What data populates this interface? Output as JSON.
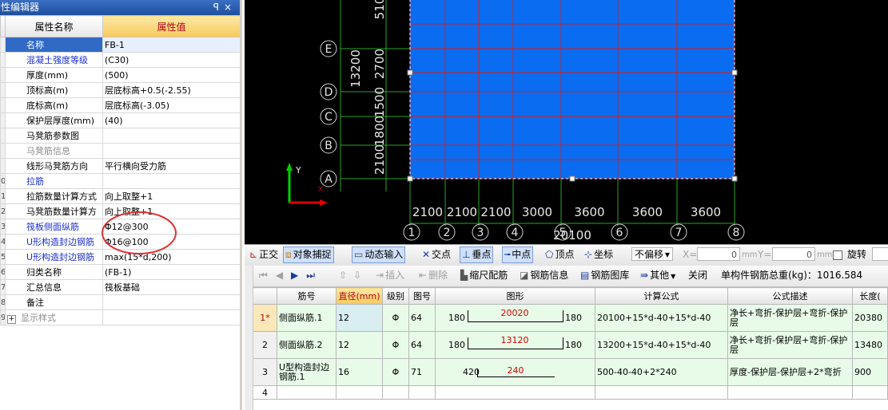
{
  "prop_editor": {
    "title": "性编辑器",
    "title_buttons": "ꟼ ×",
    "header_name": "属性名称",
    "header_value": "属性值",
    "rows": [
      {
        "num": "",
        "name": "名称",
        "value": "FB-1",
        "style": "selected"
      },
      {
        "num": "",
        "name": "混凝土强度等级",
        "value": "(C30)",
        "style": "blue"
      },
      {
        "num": "",
        "name": "厚度(mm)",
        "value": "(500)",
        "style": ""
      },
      {
        "num": "",
        "name": "顶标高(m)",
        "value": "层底标高+0.5(-2.55)",
        "style": ""
      },
      {
        "num": "",
        "name": "底标高(m)",
        "value": "层底标高(-3.05)",
        "style": ""
      },
      {
        "num": "",
        "name": "保护层厚度(mm)",
        "value": "(40)",
        "style": ""
      },
      {
        "num": "",
        "name": "马凳筋参数图",
        "value": "",
        "style": ""
      },
      {
        "num": "",
        "name": "马凳筋信息",
        "value": "",
        "style": "gray"
      },
      {
        "num": "",
        "name": "线形马凳筋方向",
        "value": "平行横向受力筋",
        "style": ""
      },
      {
        "num": "0",
        "name": "拉筋",
        "value": "",
        "style": "blue"
      },
      {
        "num": "1",
        "name": "拉筋数量计算方式",
        "value": "向上取整+1",
        "style": ""
      },
      {
        "num": "2",
        "name": "马凳筋数量计算方",
        "value": "向上取整+1",
        "style": ""
      },
      {
        "num": "3",
        "name": "筏板侧面纵筋",
        "value": "Φ12@300",
        "style": "blue"
      },
      {
        "num": "4",
        "name": "U形构造封边钢筋",
        "value": "Φ16@100",
        "style": "blue"
      },
      {
        "num": "5",
        "name": "U形构造封边钢筋",
        "value": "max(15*d,200)",
        "style": "blue"
      },
      {
        "num": "6",
        "name": "归类名称",
        "value": "(FB-1)",
        "style": ""
      },
      {
        "num": "7",
        "name": "汇总信息",
        "value": "筏板基础",
        "style": ""
      },
      {
        "num": "8",
        "name": "备注",
        "value": "",
        "style": ""
      },
      {
        "num": "9",
        "name": "显示样式",
        "value": "",
        "style": "expand"
      }
    ]
  },
  "canvas": {
    "bg": "#000000",
    "slab_color": "#0a6cf0",
    "axis_labels_y": [
      "E",
      "D",
      "C",
      "B",
      "A"
    ],
    "axis_labels_x": [
      "1",
      "2",
      "3",
      "4",
      "5",
      "6",
      "7",
      "8"
    ],
    "dims_x": [
      "2100",
      "2100",
      "2100",
      "3000",
      "3600",
      "3600",
      "3600"
    ],
    "total_x": "20100",
    "dim_left_total": "13200",
    "dims_left": [
      "2100",
      "1800",
      "1500",
      "2700",
      "510"
    ],
    "ucs_y": "Y",
    "ucs_x": "X"
  },
  "toolbar1": {
    "items": [
      "正交",
      "对象捕捉",
      "动态输入",
      "交点",
      "垂点",
      "中点",
      "顶点",
      "坐标",
      "不偏移"
    ],
    "x_label": "X=",
    "x_value": "0",
    "y_label": "Y=",
    "y_value": "0",
    "unit": "mm",
    "rotate_label": "旋转"
  },
  "toolbar2": {
    "insert": "插入",
    "delete": "删除",
    "scale": "缩尺配筋",
    "rebar_info": "钢筋信息",
    "rebar_lib": "钢筋图库",
    "other": "其他",
    "close": "关闭",
    "total_label": "单构件钢筋总重(kg)：1016.584"
  },
  "rebar_table": {
    "headers": [
      "筋号",
      "直径(mm)",
      "级别",
      "图号",
      "图形",
      "计算公式",
      "公式描述",
      "长度("
    ],
    "rows": [
      {
        "no": "1*",
        "name": "侧面纵筋.1",
        "dia": "12",
        "grade": "Φ",
        "fig": "64",
        "left": "180",
        "mid": "20020",
        "right": "180",
        "formula": "20100+15*d-40+15*d-40",
        "desc": "净长+弯折-保护层+弯折-保护层",
        "len": "20380"
      },
      {
        "no": "2",
        "name": "侧面纵筋.2",
        "dia": "12",
        "grade": "Φ",
        "fig": "64",
        "left": "180",
        "mid": "13120",
        "right": "180",
        "formula": "13200+15*d-40+15*d-40",
        "desc": "净长+弯折-保护层+弯折-保护层",
        "len": "13480"
      },
      {
        "no": "3",
        "name": "U型构造封边钢筋.1",
        "dia": "16",
        "grade": "Φ",
        "fig": "71",
        "left": "420",
        "mid": "240",
        "right": "",
        "formula": "500-40-40+2*240",
        "desc": "厚度-保护层-保护层+2*弯折",
        "len": "900"
      },
      {
        "no": "4",
        "name": "",
        "dia": "",
        "grade": "",
        "fig": "",
        "left": "",
        "mid": "",
        "right": "",
        "formula": "",
        "desc": "",
        "len": ""
      }
    ]
  }
}
